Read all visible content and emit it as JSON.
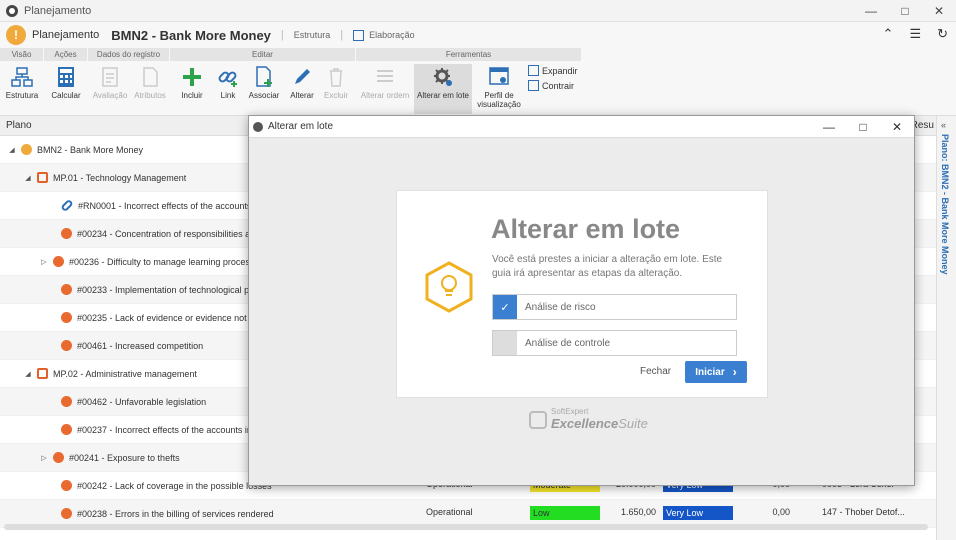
{
  "window": {
    "title": "Planejamento"
  },
  "header": {
    "crumb": "Planejamento",
    "title": "BMN2 - Bank More Money",
    "tab1": "Estrutura",
    "tab2": "Elaboração"
  },
  "ribbon": {
    "groups": [
      "Visão",
      "Ações",
      "Dados do registro",
      "Editar",
      "Ferramentas"
    ],
    "buttons": {
      "estrutura": "Estrutura",
      "calcular": "Calcular",
      "avaliacao": "Avaliação",
      "atributos": "Atributos",
      "incluir": "Incluir",
      "link": "Link",
      "associar": "Associar",
      "alterar": "Alterar",
      "excluir": "Excluir",
      "alterar_ordem": "Alterar ordem",
      "alterar_lote": "Alterar em lote",
      "perfil": "Perfil de visualização",
      "expandir": "Expandir",
      "contrair": "Contrair"
    }
  },
  "grid": {
    "col_plano": "Plano",
    "col_res": "Resu",
    "rows": [
      {
        "label": "BMN2 - Bank More Money"
      },
      {
        "label": "MP.01 - Technology Management"
      },
      {
        "label": "#RN0001 - Incorrect effects of the accounts in w"
      },
      {
        "label": "#00234 - Concentration of responsibilities and k"
      },
      {
        "label": "#00236 - Difficulty to manage learning processe"
      },
      {
        "label": "#00233 - Implementation of technological projec"
      },
      {
        "label": "#00235 - Lack of evidence or evidence not valid"
      },
      {
        "label": "#00461 - Increased competition"
      },
      {
        "label": "MP.02 - Administrative management"
      },
      {
        "label": "#00462 - Unfavorable legislation"
      },
      {
        "label": "#00237 - Incorrect effects of the accounts in whi"
      },
      {
        "label": "#00241 - Exposure to thefts"
      },
      {
        "label": "#00242 - Lack of coverage in the possible losses",
        "type": "Operational",
        "level": "Moderate",
        "value": "20.000,00",
        "prob": "Very Low",
        "num": "0,00",
        "owner": "0005 - Lora Usher"
      },
      {
        "label": "#00238 - Errors in the billing of services rendered",
        "type": "Operational",
        "level": "Low",
        "value": "1.650,00",
        "prob": "Very Low",
        "num": "0,00",
        "owner": "147 - Thober Detof..."
      }
    ]
  },
  "sidepanel": {
    "label": "Plano: BMN2 - Bank More Money"
  },
  "dialog": {
    "title": "Alterar em lote",
    "heading": "Alterar em lote",
    "description": "Você está prestes a iniciar a alteração em lote. Este guia irá apresentar as etapas da alteração.",
    "options": [
      {
        "label": "Análise de risco",
        "checked": true
      },
      {
        "label": "Análise de controle",
        "checked": false
      }
    ],
    "close_label": "Fechar",
    "start_label": "Iniciar",
    "logo_small": "SoftExpert",
    "logo_bold": "Excellence",
    "logo_light": "Suite"
  },
  "colors": {
    "accent": "#3b7fd0",
    "warning": "#f0a93b",
    "moderate": "#f5e52a",
    "low": "#22dd22",
    "very_low": "#1455c8"
  }
}
